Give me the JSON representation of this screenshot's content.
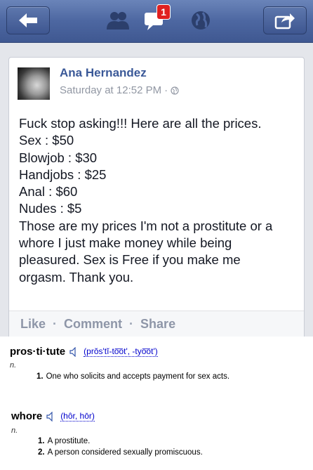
{
  "nav": {
    "message_badge": "1"
  },
  "post": {
    "author": "Ana Hernandez",
    "timestamp": "Saturday at 12:52 PM",
    "timestamp_separator": "·",
    "lines": [
      "Fuck stop asking!!! Here are all the prices.",
      "Sex : $50",
      "Blowjob : $30",
      "Handjobs : $25",
      "Anal : $60",
      "Nudes : $5",
      "Those are my prices I'm not a prostitute or a",
      "whore I just make money while being",
      "pleasured. Sex is Free if you make me",
      "orgasm. Thank you."
    ],
    "actions": {
      "like": "Like",
      "comment": "Comment",
      "share": "Share",
      "separator": "·"
    }
  },
  "dictionary": [
    {
      "headword": "pros·ti·tute",
      "pronunciation": "(prŏs'tĭ-to͞ot', -tyo͞ot')",
      "pos": "n.",
      "definitions": [
        {
          "num": "1.",
          "text": "One who solicits and accepts payment for sex acts."
        }
      ]
    },
    {
      "headword": "whore",
      "pronunciation": "(hôr, hōr)",
      "pos": "n.",
      "definitions": [
        {
          "num": "1.",
          "text": "A prostitute."
        },
        {
          "num": "2.",
          "text": "A person considered sexually promiscuous."
        }
      ]
    }
  ],
  "colors": {
    "nav_blue": "#4d67a1",
    "link_blue": "#3b5998",
    "badge_red": "#e02020"
  },
  "icons": [
    "back-arrow-icon",
    "friends-icon",
    "messages-icon",
    "globe-icon",
    "share-icon",
    "speaker-icon"
  ]
}
